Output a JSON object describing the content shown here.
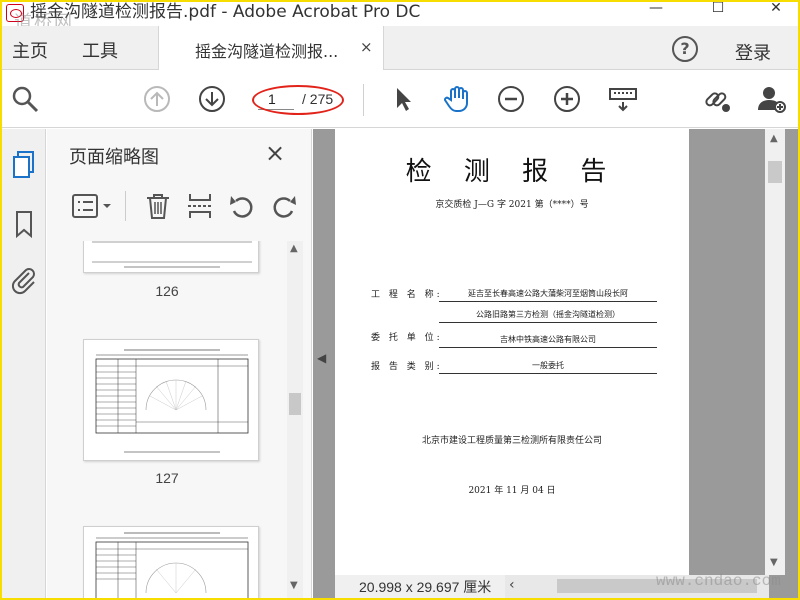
{
  "window": {
    "title": "摇金沟隧道检测报告.pdf - Adobe Acrobat Pro DC",
    "watermark": "道桥网",
    "buttons": {
      "minimize": "—",
      "maximize": "☐",
      "close": "✕"
    }
  },
  "tabs": {
    "home": "主页",
    "tools": "工具",
    "document": "摇金沟隧道检测报...",
    "close": "×"
  },
  "header": {
    "help": "?",
    "login": "登录"
  },
  "toolbar": {
    "page_current": "1",
    "page_total": "/ 275",
    "icons": [
      "search-icon",
      "page-up-icon",
      "page-down-icon",
      "select-cursor-icon",
      "hand-icon",
      "zoom-out-icon",
      "zoom-in-icon",
      "keyboard-icon",
      "share-link-icon",
      "add-user-icon"
    ]
  },
  "left_rail": {
    "icons": [
      "page-thumbnails-icon",
      "bookmark-icon",
      "attachment-icon"
    ]
  },
  "thumbnails_panel": {
    "title": "页面缩略图",
    "close": "×",
    "tools": [
      "options-menu-icon",
      "delete-icon",
      "insert-icon",
      "rotate-ccw-icon",
      "rotate-cw-icon"
    ],
    "pages": [
      "126",
      "127",
      ""
    ]
  },
  "document": {
    "title": "检 测 报 告",
    "subtitle": "京交质检 J—G 字 2021 第（****）号",
    "fields": [
      {
        "label": "工 程 名 称:",
        "value_line1": "延吉至长春高速公路大蒲柴河至烟筒山段长阿",
        "value_line2": "公路旧路第三方检测（摇金沟隧道检测）"
      },
      {
        "label": "委 托 单 位:",
        "value": "吉林中铁高速公路有限公司"
      },
      {
        "label": "报 告 类 别:",
        "value": "一般委托"
      }
    ],
    "organization": "北京市建设工程质量第三检测所有限责任公司",
    "date": "2021 年 11 月 04 日"
  },
  "status_bar": {
    "dimensions": "20.998 x 29.697 厘米"
  },
  "watermark_bottom": "www.cndao.com"
}
